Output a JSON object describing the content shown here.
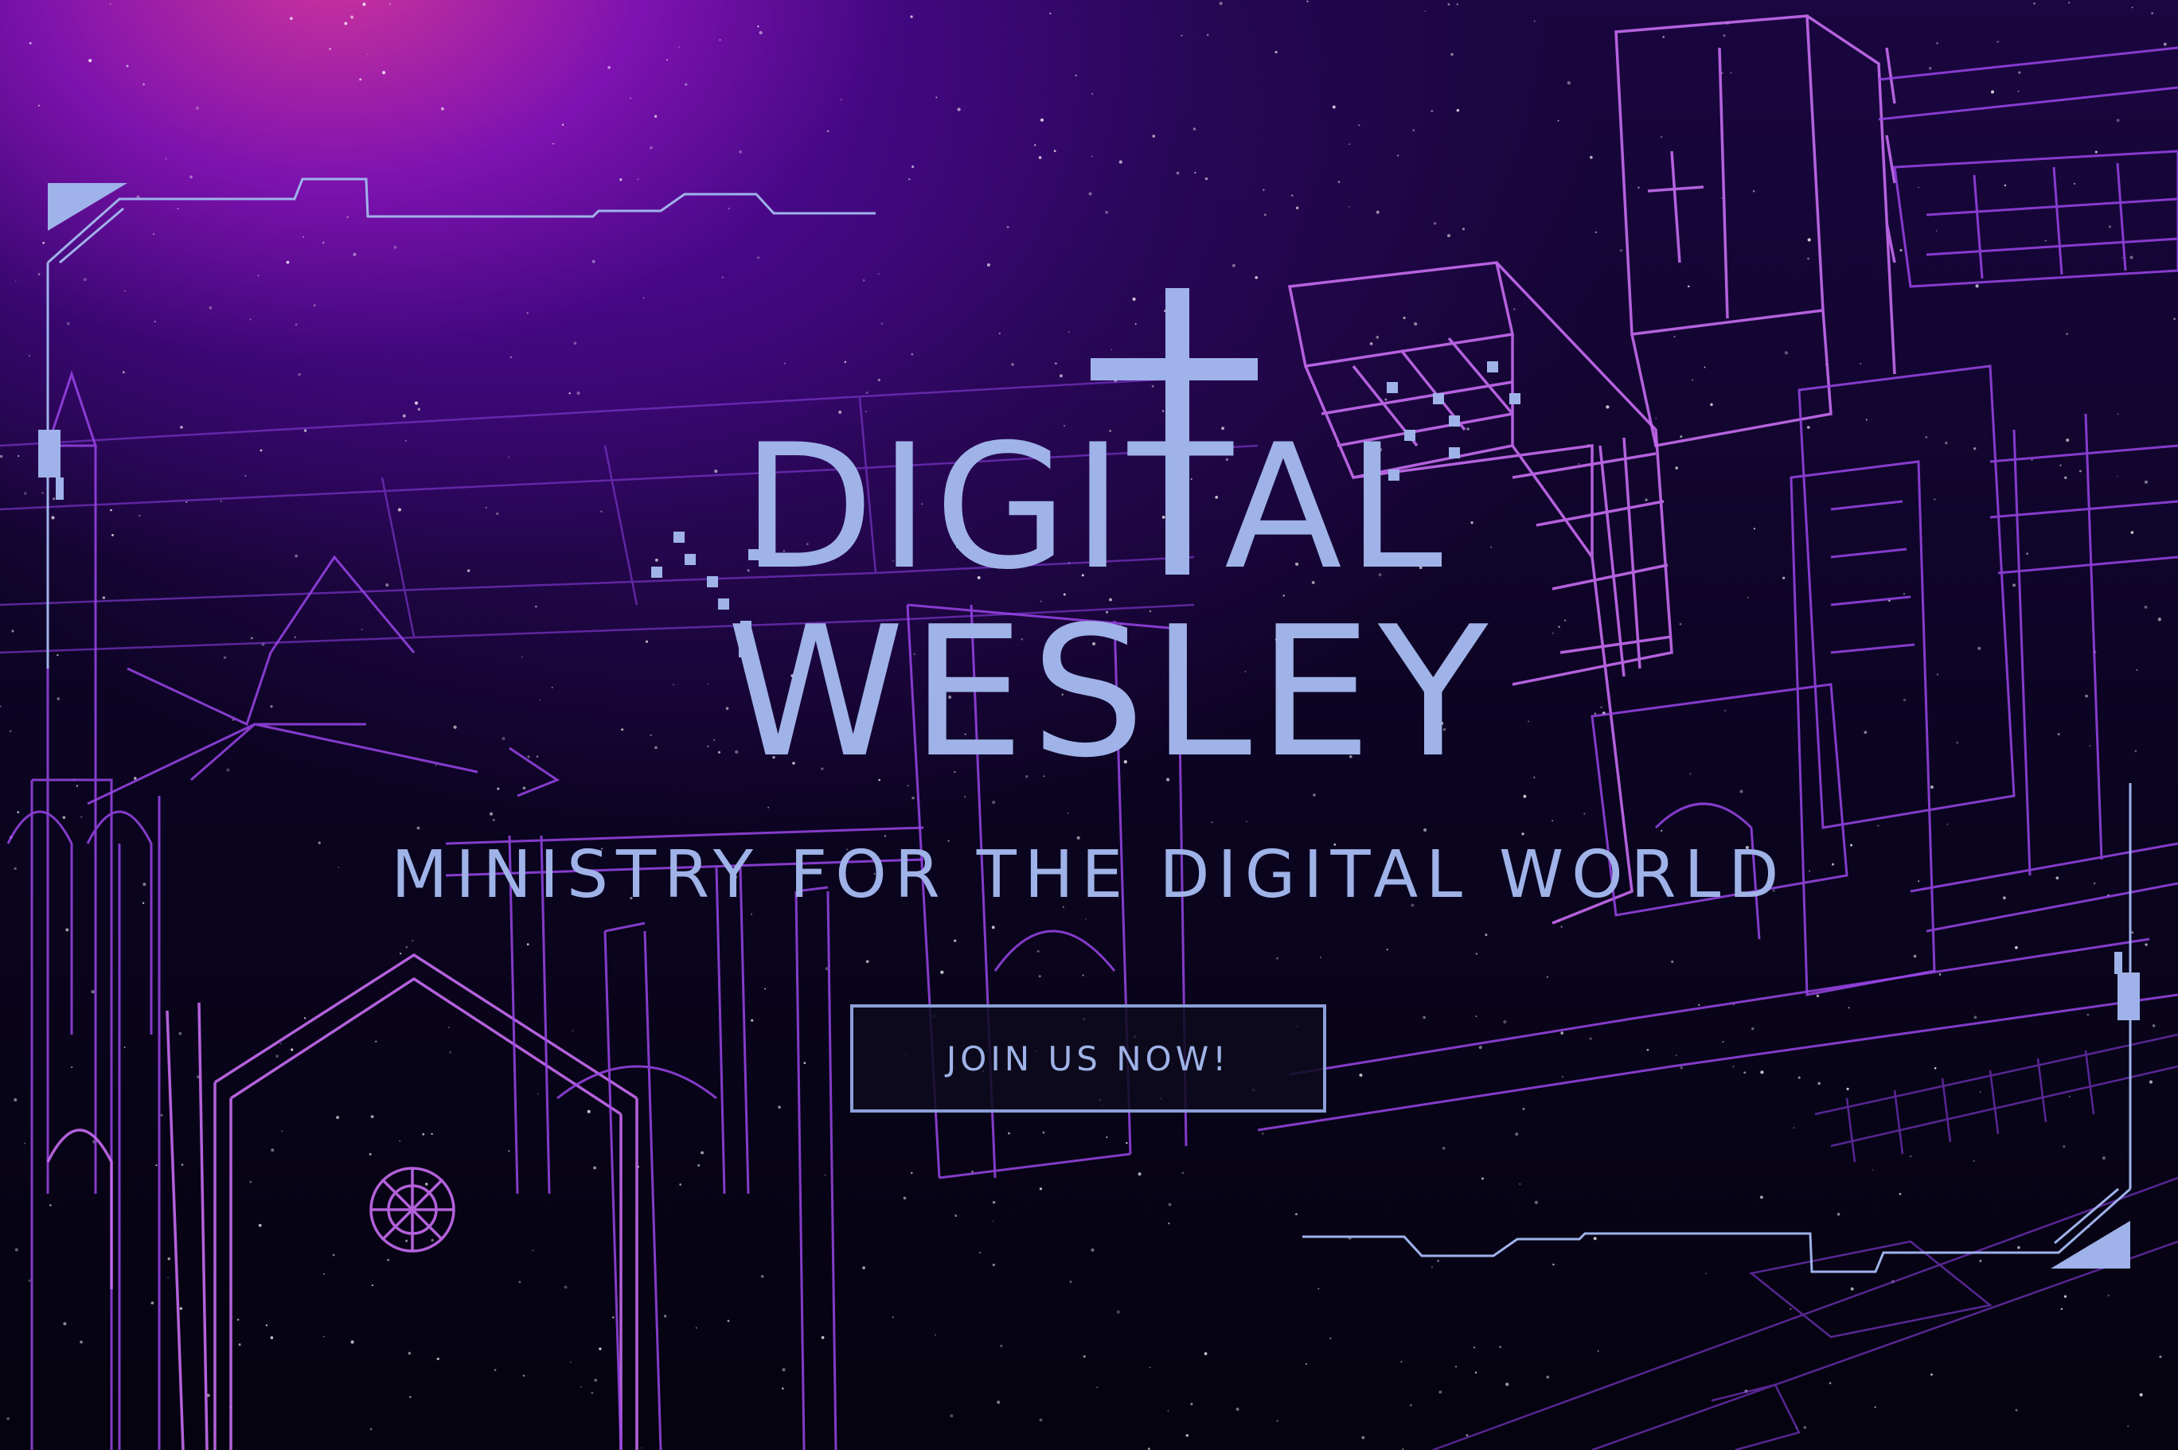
{
  "hero": {
    "logo_line1": "DIGITAL",
    "logo_line2": "WESLEY",
    "tagline": "MINISTRY FOR THE DIGITAL WORLD",
    "cta_label": "JOIN US NOW!"
  },
  "colors": {
    "accent": "#9fb3e8",
    "wireframe": "#9a45e8",
    "glow": "#d636a0",
    "background": "#05030f"
  },
  "icons": [
    "cross-icon",
    "pixel-sparkle-icon"
  ]
}
